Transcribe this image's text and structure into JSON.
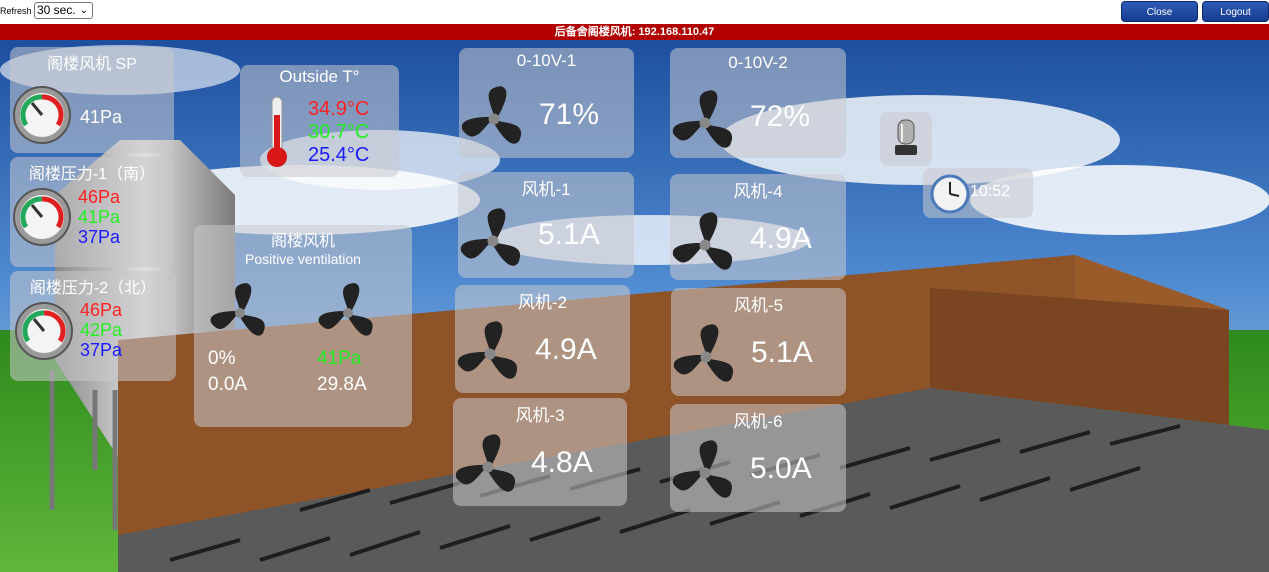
{
  "toolbar": {
    "refresh_label": "Refresh",
    "refresh_value": "30 sec.",
    "close_label": "Close",
    "logout_label": "Logout"
  },
  "title": "后备舍阁楼风机: 192.168.110.47",
  "sp_panel": {
    "title": "阁楼风机 SP",
    "value": "41Pa"
  },
  "pressure1": {
    "title": "阁楼压力-1（南）",
    "values": [
      "46Pa",
      "41Pa",
      "37Pa"
    ]
  },
  "pressure2": {
    "title": "阁楼压力-2（北）",
    "values": [
      "46Pa",
      "42Pa",
      "37Pa"
    ]
  },
  "outside": {
    "title": "Outside T°",
    "values": [
      "34.9°C",
      "30.7°C",
      "25.4°C"
    ]
  },
  "attic_fan": {
    "title": "阁楼风机",
    "subtitle": "Positive ventilation",
    "fan1_percent": "0%",
    "fan1_current": "0.0A",
    "fan2_pressure": "41Pa",
    "fan2_current": "29.8A"
  },
  "v1": {
    "title": "0-10V-1",
    "value": "71%"
  },
  "v2": {
    "title": "0-10V-2",
    "value": "72%"
  },
  "fans": [
    {
      "title": "风机-1",
      "value": "5.1A"
    },
    {
      "title": "风机-2",
      "value": "4.9A"
    },
    {
      "title": "风机-3",
      "value": "4.8A"
    },
    {
      "title": "风机-4",
      "value": "4.9A"
    },
    {
      "title": "风机-5",
      "value": "5.1A"
    },
    {
      "title": "风机-6",
      "value": "5.0A"
    }
  ],
  "clock": {
    "time": "10:52"
  },
  "colors": {
    "title_bar": "#b20000",
    "button": "#1f4aa5",
    "red": "#ff2020",
    "green": "#22ee22",
    "blue": "#1a1aff"
  },
  "icons": [
    "fan-icon",
    "gauge-icon",
    "thermometer-icon",
    "clock-icon",
    "alarm-beacon-icon"
  ]
}
